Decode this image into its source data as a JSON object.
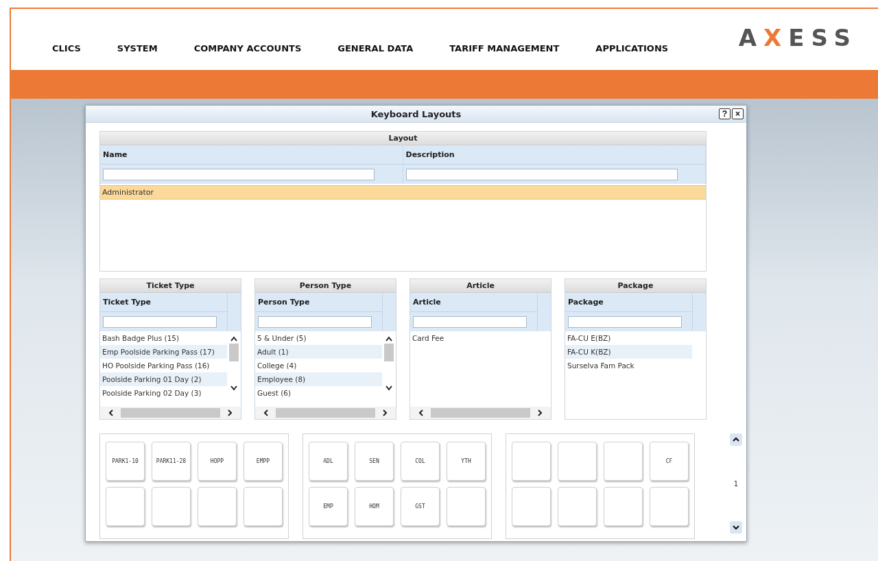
{
  "nav": {
    "items": [
      "CLICS",
      "SYSTEM",
      "COMPANY ACCOUNTS",
      "GENERAL DATA",
      "TARIFF MANAGEMENT",
      "APPLICATIONS"
    ],
    "logo": "AXESS"
  },
  "dialog": {
    "title": "Keyboard Layouts",
    "help": "?",
    "close": "×",
    "layout": {
      "title": "Layout",
      "columns": [
        "Name",
        "Description"
      ],
      "rows": [
        {
          "name": "Administrator",
          "selected": true
        }
      ]
    },
    "panels": [
      {
        "title": "Ticket Type",
        "column": "Ticket Type",
        "vertical_scrollbar": true,
        "horizontal_scrollbar": true,
        "items": [
          "Bash Badge Plus  (15)",
          "Emp Poolside Parking Pass  (17)",
          "HO Poolside Parking Pass  (16)",
          "Poolside Parking 01 Day  (2)",
          "Poolside Parking 02 Day  (3)"
        ]
      },
      {
        "title": "Person Type",
        "column": "Person Type",
        "vertical_scrollbar": true,
        "horizontal_scrollbar": true,
        "items": [
          "5 & Under  (5)",
          "Adult  (1)",
          "College  (4)",
          "Employee  (8)",
          "Guest  (6)"
        ]
      },
      {
        "title": "Article",
        "column": "Article",
        "vertical_scrollbar": false,
        "horizontal_scrollbar": true,
        "items": [
          "Card Fee"
        ]
      },
      {
        "title": "Package",
        "column": "Package",
        "vertical_scrollbar": false,
        "horizontal_scrollbar": false,
        "items": [
          "FA-CU E(BZ)",
          "FA-CU K(BZ)",
          "Surselva Fam Pack"
        ]
      }
    ],
    "keypads": [
      {
        "keys": [
          {
            "kind": "labeled",
            "label": "PARK1-10"
          },
          {
            "kind": "labeled",
            "label": "PARK11-28"
          },
          {
            "kind": "labeled",
            "label": "HOPP"
          },
          {
            "kind": "labeled",
            "label": "EMPP"
          },
          {
            "kind": "blank"
          },
          {
            "kind": "blank"
          },
          {
            "kind": "blank"
          },
          {
            "kind": "blank"
          }
        ]
      },
      {
        "keys": [
          {
            "kind": "labeled",
            "label": "ADL"
          },
          {
            "kind": "labeled",
            "label": "SEN"
          },
          {
            "kind": "labeled",
            "label": "COL"
          },
          {
            "kind": "labeled",
            "label": "YTH"
          },
          {
            "kind": "labeled",
            "label": "EMP"
          },
          {
            "kind": "labeled",
            "label": "HOM"
          },
          {
            "kind": "labeled",
            "label": "GST"
          },
          {
            "kind": "blank"
          }
        ]
      },
      {
        "keys": [
          {
            "kind": "blank"
          },
          {
            "kind": "blank"
          },
          {
            "kind": "blank"
          },
          {
            "kind": "labeled",
            "label": "CF"
          },
          {
            "kind": "blank"
          },
          {
            "kind": "blank"
          },
          {
            "kind": "blank"
          },
          {
            "kind": "blank"
          }
        ]
      }
    ],
    "page": "1"
  }
}
